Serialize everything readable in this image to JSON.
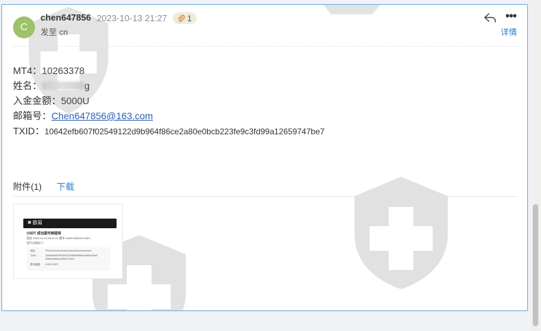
{
  "email": {
    "avatar_letter": "C",
    "sender": "chen647856",
    "date": "2023-10-13 21:27",
    "attachment_count": "1",
    "to_label": "发至",
    "to_value": "cn",
    "translate_label": "详情",
    "more_label": "•••"
  },
  "body": {
    "mt4_label": "MT4：",
    "mt4_value": "10263378",
    "name_label": "姓名：",
    "name_value_visible": "g",
    "deposit_label": "入金金额：",
    "deposit_value": "5000U",
    "email_label": "邮箱号：",
    "email_value": "Chen647856@163.com",
    "txid_label": "TXID：",
    "txid_value": "10642efb607f02549122d9b964f86ce2a80e0bcb223fe9c3fd99a12659747be7"
  },
  "attachments": {
    "tab_label": "附件(1)",
    "download_label": "下载",
    "thumb": {
      "brand": "✖ 欧易",
      "title": "USDT 成功提币转提现",
      "line1": "您在 2023-10-13 20:41:12 提币 5,000.000000 USDT,",
      "line2": "提币详情如下：",
      "rows": [
        {
          "k": "地址：",
          "v": "TFxxxxxxxxxxxxxxxxxxxxxxxxxxxxxxxxxxxx"
        },
        {
          "k": "TXID：",
          "v": "10642efb607f02549122d9b964f86ce2a80e0bcb2"
        },
        {
          "k": "",
          "v": "23fe9c3fd99a12659747be7"
        },
        {
          "k": "提币金额：",
          "v": "5,000 USDT"
        }
      ]
    }
  },
  "colors": {
    "accent": "#2f7fd0",
    "avatar": "#9dc26a",
    "card_border": "#6aa9d8",
    "watermark": "#dcdcdc"
  }
}
